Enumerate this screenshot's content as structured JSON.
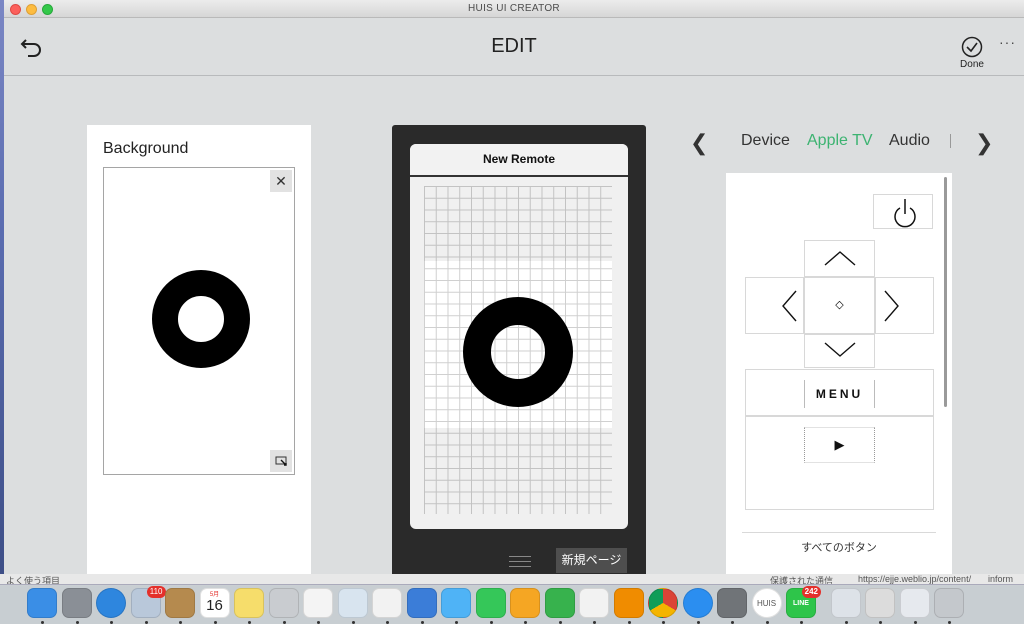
{
  "window": {
    "title": "HUIS UI CREATOR"
  },
  "header": {
    "title": "EDIT",
    "done_label": "Done",
    "more_label": "···"
  },
  "background_panel": {
    "heading": "Background",
    "close_symbol": "✕"
  },
  "remote": {
    "title": "New Remote",
    "new_page_label": "新規ページ"
  },
  "palette_nav": {
    "prev_symbol": "❮",
    "next_symbol": "❯",
    "tabs": [
      {
        "label": "Device",
        "active": false
      },
      {
        "label": "Apple TV",
        "active": true
      },
      {
        "label": "Audio",
        "active": false
      }
    ],
    "active_color": "#3cb371"
  },
  "palette": {
    "menu_label": "MENU",
    "play_symbol": "▶",
    "center_symbol": "◇",
    "all_buttons_label": "すべてのボタン"
  },
  "behind_window": {
    "left_text": "よく使う項目",
    "mid_text": "保護された通信",
    "url_text": "https://ejje.weblio.jp/content/",
    "right_text": "inform"
  },
  "dock": {
    "items": [
      {
        "name": "finder",
        "color": "#3a8ee6",
        "badge": ""
      },
      {
        "name": "launchpad",
        "color": "#8a8f96",
        "badge": ""
      },
      {
        "name": "safari",
        "color": "#2e86de",
        "badge": ""
      },
      {
        "name": "mail-stamps",
        "color": "#b9c8da",
        "badge": "110"
      },
      {
        "name": "contacts",
        "color": "#b58a4e",
        "badge": ""
      },
      {
        "name": "calendar",
        "color": "#ffffff",
        "badge": ""
      },
      {
        "name": "notes",
        "color": "#f6dd6b",
        "badge": ""
      },
      {
        "name": "help",
        "color": "#c9ccd0",
        "badge": ""
      },
      {
        "name": "reminders",
        "color": "#f4f4f4",
        "badge": ""
      },
      {
        "name": "preview",
        "color": "#d8e4ef",
        "badge": ""
      },
      {
        "name": "photos",
        "color": "#f2f2f2",
        "badge": ""
      },
      {
        "name": "keynote",
        "color": "#3b7dd8",
        "badge": ""
      },
      {
        "name": "messages",
        "color": "#4fb3f6",
        "badge": ""
      },
      {
        "name": "facetime",
        "color": "#35c759",
        "badge": ""
      },
      {
        "name": "pages",
        "color": "#f5a623",
        "badge": ""
      },
      {
        "name": "numbers",
        "color": "#37b24d",
        "badge": ""
      },
      {
        "name": "itunes",
        "color": "#f2f2f2",
        "badge": ""
      },
      {
        "name": "ibooks",
        "color": "#f08c00",
        "badge": ""
      },
      {
        "name": "chrome",
        "color": "#e8e8e8",
        "badge": ""
      },
      {
        "name": "app-store",
        "color": "#2b8ef0",
        "badge": ""
      },
      {
        "name": "system-preferences",
        "color": "#707478",
        "badge": ""
      },
      {
        "name": "huis",
        "color": "#ffffff",
        "badge": ""
      },
      {
        "name": "line",
        "color": "#2ec54a",
        "badge": "242"
      },
      {
        "name": "downloads-stack",
        "color": "#dde2e8",
        "badge": ""
      },
      {
        "name": "documents-stack",
        "color": "#dcdcdc",
        "badge": ""
      },
      {
        "name": "desktop-stack",
        "color": "#e6e9ee",
        "badge": ""
      },
      {
        "name": "trash",
        "color": "#c4c8cc",
        "badge": ""
      }
    ],
    "calendar": {
      "month": "5月",
      "day": "16"
    },
    "huis_label": "HUIS",
    "line_label": "LINE"
  }
}
